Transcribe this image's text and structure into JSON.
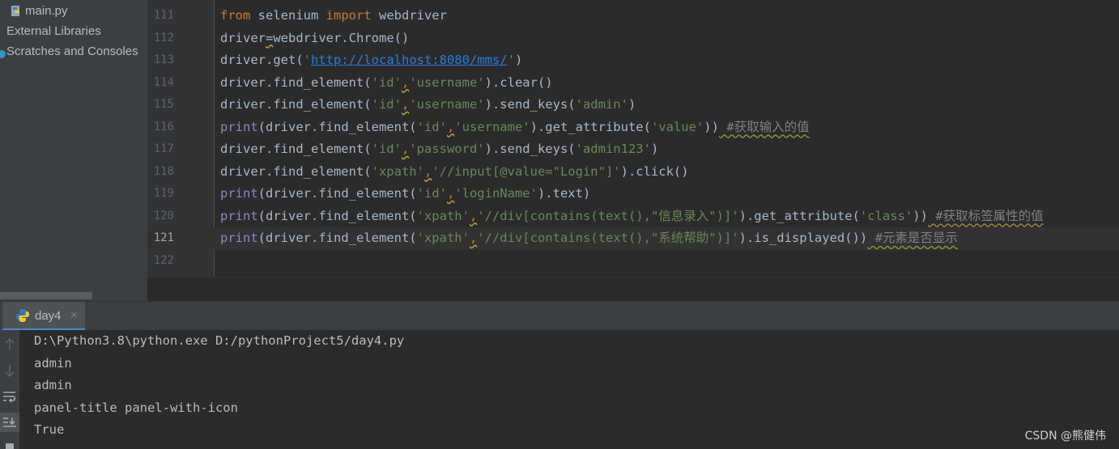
{
  "sidebar": {
    "items": [
      {
        "label": "main.py",
        "icon": "python-file-icon"
      },
      {
        "label": "External Libraries",
        "icon": "library-icon"
      },
      {
        "label": "Scratches and Consoles",
        "icon": "scratch-icon"
      }
    ]
  },
  "editor": {
    "current_line": "121",
    "lines": [
      {
        "num": "111"
      },
      {
        "num": "112"
      },
      {
        "num": "113"
      },
      {
        "num": "114"
      },
      {
        "num": "115"
      },
      {
        "num": "116"
      },
      {
        "num": "117"
      },
      {
        "num": "118"
      },
      {
        "num": "119"
      },
      {
        "num": "120"
      },
      {
        "num": "121"
      },
      {
        "num": "122"
      }
    ],
    "tokens": {
      "l111": [
        "from",
        " selenium ",
        "import",
        " webdriver"
      ],
      "l112": [
        "driver",
        "=",
        "webdriver.Chrome()"
      ],
      "l113": [
        "driver.get(",
        "'",
        "http://localhost:8080/mms/",
        "'",
        ")"
      ],
      "l114": [
        "driver.find_element(",
        "'id'",
        ",",
        "'username'",
        ").clear()"
      ],
      "l115": [
        "driver.find_element(",
        "'id'",
        ",",
        "'username'",
        ").send_keys(",
        "'admin'",
        ")"
      ],
      "l116": [
        "print",
        "(driver.find_element(",
        "'id'",
        ",",
        "'username'",
        ").get_attribute(",
        "'value'",
        "))",
        " #获取输入的值"
      ],
      "l117": [
        "driver.find_element(",
        "'id'",
        ",",
        "'password'",
        ").send_keys(",
        "'admin123'",
        ")"
      ],
      "l118": [
        "driver.find_element(",
        "'xpath'",
        ",",
        "'//input[@value=\"Login\"]'",
        ").click()"
      ],
      "l119": [
        "print",
        "(driver.find_element(",
        "'id'",
        ",",
        "'loginName'",
        ").text)"
      ],
      "l120": [
        "print",
        "(driver.find_element(",
        "'xpath'",
        ",",
        "'//div[contains(text(),\"信息录入\")]'",
        ").get_attribute(",
        "'class'",
        "))",
        " #获取标签属性的值"
      ],
      "l121": [
        "print",
        "(driver.find_element(",
        "'xpath'",
        ",",
        "'//div[contains(text(),\"系统帮助\")]'",
        ").is_displayed())",
        " #元素是否显示"
      ]
    }
  },
  "run": {
    "tab_label": "day4",
    "tab_close": "×",
    "output": [
      "D:\\Python3.8\\python.exe D:/pythonProject5/day4.py",
      "admin",
      "admin",
      "panel-title panel-with-icon",
      "True"
    ]
  },
  "watermark": "CSDN @熊健伟",
  "colors": {
    "keyword": "#cc7832",
    "string": "#6a8759",
    "builtin": "#8888c6",
    "link": "#287bde",
    "accent_tab": "#4a88c7"
  }
}
